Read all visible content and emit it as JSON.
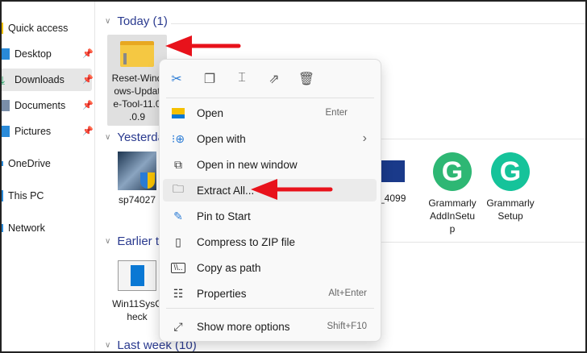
{
  "sidebar": {
    "items": [
      {
        "label": "Quick access",
        "icon": "star-icon",
        "pinned": false
      },
      {
        "label": "Desktop",
        "icon": "desktop-icon",
        "pinned": true
      },
      {
        "label": "Downloads",
        "icon": "download-icon",
        "pinned": true,
        "selected": true
      },
      {
        "label": "Documents",
        "icon": "documents-icon",
        "pinned": true
      },
      {
        "label": "Pictures",
        "icon": "pictures-icon",
        "pinned": true
      },
      {
        "label": "OneDrive",
        "icon": "cloud-icon",
        "pinned": false
      },
      {
        "label": "This PC",
        "icon": "pc-icon",
        "pinned": false
      },
      {
        "label": "Network",
        "icon": "network-icon",
        "pinned": false
      }
    ]
  },
  "groups": {
    "today": "Today (1)",
    "yesterday": "Yesterday",
    "earlier": "Earlier this week",
    "last_week": "Last week (10)"
  },
  "files": {
    "zip": [
      "Reset-Wind",
      "ows-Updat",
      "e-Tool-11.0",
      ".0.9"
    ],
    "sp": "sp74027",
    "g4099": "_4099",
    "grammarly_addin": [
      "Grammarly",
      "AddInSetu",
      "p"
    ],
    "grammarly_setup": [
      "Grammarly",
      "Setup"
    ],
    "win11": [
      "Win11SysC",
      "heck"
    ]
  },
  "menu": {
    "toolbar": [
      "cut-icon",
      "copy-icon",
      "rename-icon",
      "share-icon",
      "delete-icon"
    ],
    "items": [
      {
        "label": "Open",
        "shortcut": "Enter"
      },
      {
        "label": "Open with",
        "shortcut": "›"
      },
      {
        "label": "Open in new window",
        "shortcut": ""
      },
      {
        "label": "Extract All...",
        "shortcut": ""
      },
      {
        "label": "Pin to Start",
        "shortcut": ""
      },
      {
        "label": "Compress to ZIP file",
        "shortcut": ""
      },
      {
        "label": "Copy as path",
        "shortcut": ""
      },
      {
        "label": "Properties",
        "shortcut": "Alt+Enter"
      },
      {
        "label": "Show more options",
        "shortcut": "Shift+F10"
      }
    ]
  },
  "colors": {
    "accent": "#0067c0",
    "arrow": "#e8121b",
    "grammarly": "#15c39a"
  }
}
